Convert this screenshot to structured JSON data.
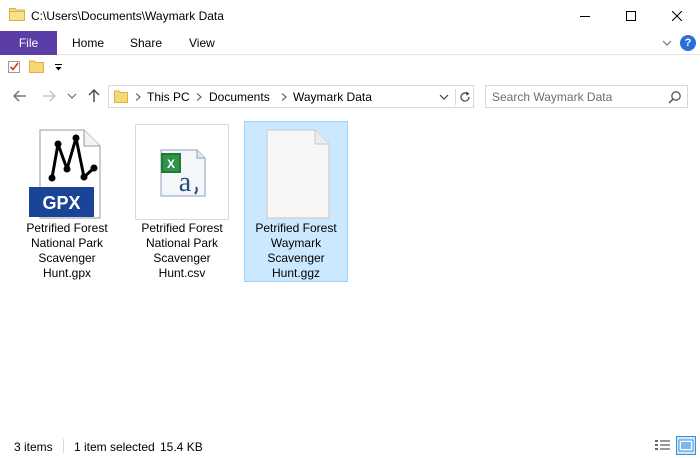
{
  "window": {
    "title": "C:\\Users\\Documents\\Waymark Data"
  },
  "ribbon": {
    "file_label": "File",
    "tabs": [
      {
        "label": "Home"
      },
      {
        "label": "Share"
      },
      {
        "label": "View"
      }
    ],
    "help_label": "?"
  },
  "nav": {
    "breadcrumbs": [
      "This PC",
      "Documents",
      "Waymark Data"
    ],
    "search_placeholder": "Search Waymark Data"
  },
  "files": [
    {
      "name": "Petrified Forest National Park Scavenger Hunt.gpx",
      "icon": "gpx-file-icon",
      "badge": "GPX",
      "selected": false
    },
    {
      "name": "Petrified Forest National Park Scavenger Hunt.csv",
      "icon": "excel-csv-file-icon",
      "selected": false
    },
    {
      "name": "Petrified Forest Waymark Scavenger Hunt.ggz",
      "icon": "blank-file-icon",
      "selected": true
    }
  ],
  "status": {
    "item_count": "3 items",
    "selection": "1 item selected",
    "size": "15.4 KB"
  },
  "colors": {
    "file_tab": "#5b3ea5",
    "selection_bg": "#cce8ff",
    "selection_border": "#99d1ff",
    "gpx_badge": "#1a4597",
    "folder": "#f8d775"
  }
}
